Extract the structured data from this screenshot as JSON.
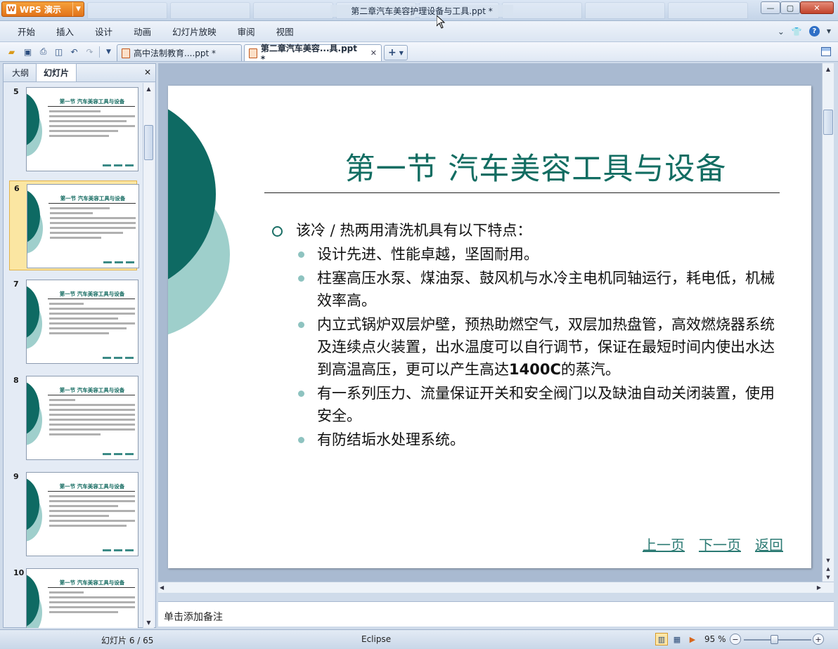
{
  "app": {
    "name": "WPS 演示",
    "window_title": "第二章汽车美容护理设备与工具.ppt *"
  },
  "menu": [
    "开始",
    "插入",
    "设计",
    "动画",
    "幻灯片放映",
    "审阅",
    "视图"
  ],
  "doc_tabs": [
    {
      "label": "高中法制教育....ppt *",
      "active": false
    },
    {
      "label": "第二章汽车美容...具.ppt *",
      "active": true
    }
  ],
  "left_panel": {
    "tabs": [
      {
        "label": "大纲",
        "active": false
      },
      {
        "label": "幻灯片",
        "active": true
      }
    ],
    "thumbnails": [
      {
        "number": "5",
        "title": "第一节 汽车美容工具与设备",
        "selected": false
      },
      {
        "number": "6",
        "title": "第一节 汽车美容工具与设备",
        "selected": true
      },
      {
        "number": "7",
        "title": "第一节 汽车美容工具与设备",
        "selected": false
      },
      {
        "number": "8",
        "title": "第一节 汽车美容工具与设备",
        "selected": false
      },
      {
        "number": "9",
        "title": "第一节 汽车美容工具与设备",
        "selected": false
      },
      {
        "number": "10",
        "title": "第一节 汽车美容工具与设备",
        "selected": false
      }
    ]
  },
  "slide": {
    "title": "第一节  汽车美容工具与设备",
    "bullet_main": "该冷 / 热两用清洗机具有以下特点：",
    "sub_bullets": [
      "设计先进、性能卓越，坚固耐用。",
      "柱塞高压水泵、煤油泵、鼓风机与水冷主电机同轴运行，耗电低，机械效率高。",
      "内立式锅炉双层炉壁，预热助燃空气，双层加热盘管，高效燃烧器系统及连续点火装置，出水温度可以自行调节，保证在最短时间内使出水达到高温高压，更可以产生高达",
      "有一系列压力、流量保证开关和安全阀门以及缺油自动关闭装置，使用安全。",
      "有防结垢水处理系统。"
    ],
    "sub_bullet3_bold": "1400C",
    "sub_bullet3_tail": "的蒸汽。",
    "links": {
      "prev": "上一页",
      "next": "下一页",
      "back": "返回"
    }
  },
  "notes_placeholder": "单击添加备注",
  "status": {
    "slide_indicator": "幻灯片 6 / 65",
    "theme": "Eclipse",
    "zoom": "95 %"
  },
  "colors": {
    "accent_dark": "#0e6a63",
    "accent_light": "#9ecfcb",
    "title": "#126d62"
  }
}
